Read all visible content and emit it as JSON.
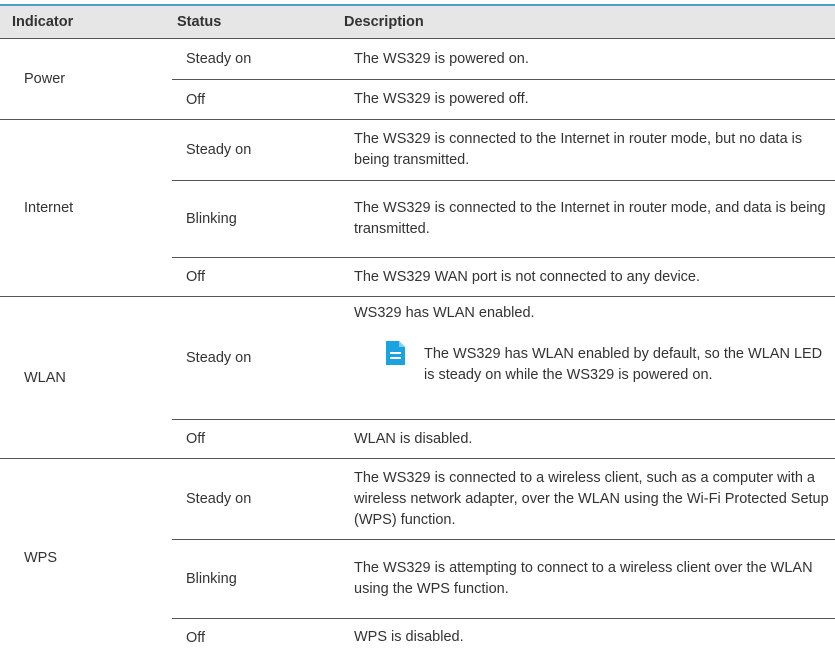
{
  "headers": {
    "indicator": "Indicator",
    "status": "Status",
    "description": "Description"
  },
  "groups": [
    {
      "indicator": "Power",
      "rows": [
        {
          "status": "Steady on",
          "description": "The WS329 is powered on."
        },
        {
          "status": "Off",
          "description": "The WS329 is powered off."
        }
      ]
    },
    {
      "indicator": "Internet",
      "rows": [
        {
          "status": "Steady on",
          "description": "The WS329 is connected to the Internet in router mode, but no data is being transmitted."
        },
        {
          "status": "Blinking",
          "description": "The WS329 is connected to the Internet in router mode, and data is being transmitted."
        },
        {
          "status": "Off",
          "description": "The WS329 WAN port is not connected to any device."
        }
      ]
    },
    {
      "indicator": "WLAN",
      "rows": [
        {
          "status": "Steady on",
          "description": "WS329 has WLAN enabled.",
          "note": "The WS329 has WLAN enabled by default, so the WLAN LED is steady on while the WS329 is powered on."
        },
        {
          "status": "Off",
          "description": "WLAN is disabled."
        }
      ]
    },
    {
      "indicator": "WPS",
      "rows": [
        {
          "status": "Steady on",
          "description": "The WS329 is connected to a wireless client, such as a computer with a wireless network adapter, over the WLAN using the Wi-Fi Protected Setup (WPS) function."
        },
        {
          "status": "Blinking",
          "description": "The WS329 is attempting to connect to a wireless client over the WLAN using the WPS function."
        },
        {
          "status": "Off",
          "description": "WPS is disabled."
        }
      ]
    }
  ],
  "note_icon": "document-note-icon",
  "colors": {
    "accent": "#4aa3c7",
    "note_icon": "#1aa3e0",
    "header_bg": "#e6e6e6"
  }
}
